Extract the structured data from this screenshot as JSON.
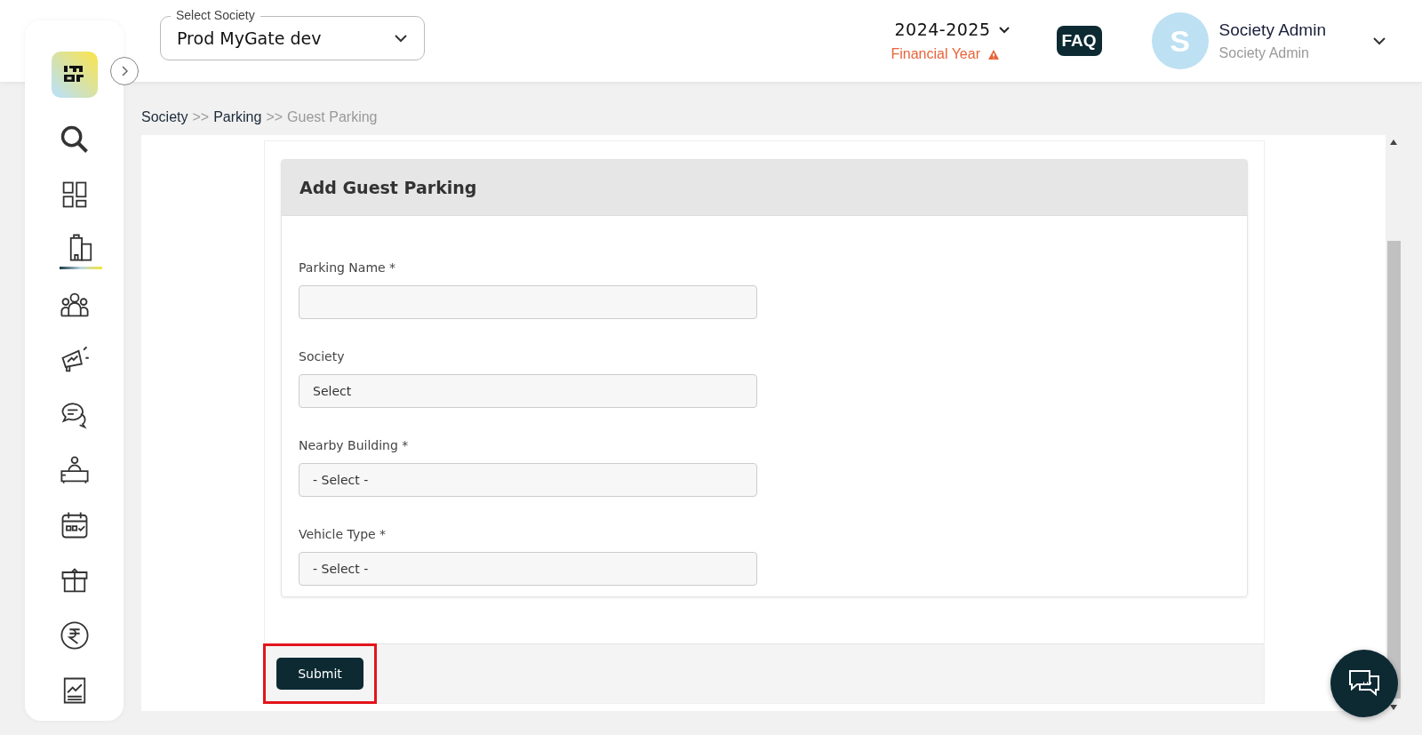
{
  "header": {
    "society_select": {
      "label": "Select Society",
      "value": "Prod MyGate dev"
    },
    "year": {
      "value": "2024-2025",
      "caption": "Financial Year"
    },
    "faq": "FAQ",
    "user": {
      "initial": "S",
      "name": "Society Admin",
      "role": "Society Admin"
    }
  },
  "sidebar": {
    "items": [
      {
        "kind": "search",
        "selected": false
      },
      {
        "kind": "dashboard",
        "selected": false
      },
      {
        "kind": "building",
        "selected": true
      },
      {
        "kind": "people",
        "selected": false
      },
      {
        "kind": "megaphone",
        "selected": false
      },
      {
        "kind": "chat",
        "selected": false
      },
      {
        "kind": "desk",
        "selected": false
      },
      {
        "kind": "calendar",
        "selected": false
      },
      {
        "kind": "box",
        "selected": false
      },
      {
        "kind": "rupee",
        "selected": false
      },
      {
        "kind": "report",
        "selected": false
      }
    ]
  },
  "breadcrumb": [
    {
      "label": "Society",
      "current": false
    },
    {
      "label": "Parking",
      "current": false
    },
    {
      "label": "Guest Parking",
      "current": true
    }
  ],
  "breadcrumb_separator": ">>",
  "form": {
    "title": "Add Guest Parking",
    "fields": [
      {
        "label": "Parking Name *",
        "kind": "text"
      },
      {
        "label": "Society",
        "kind": "select",
        "value": "Select"
      },
      {
        "label": "Nearby Building *",
        "kind": "select",
        "value": "- Select -"
      },
      {
        "label": "Vehicle Type *",
        "kind": "select",
        "value": "- Select -"
      }
    ],
    "submit": {
      "label": "Submit",
      "highlighted": true
    }
  }
}
